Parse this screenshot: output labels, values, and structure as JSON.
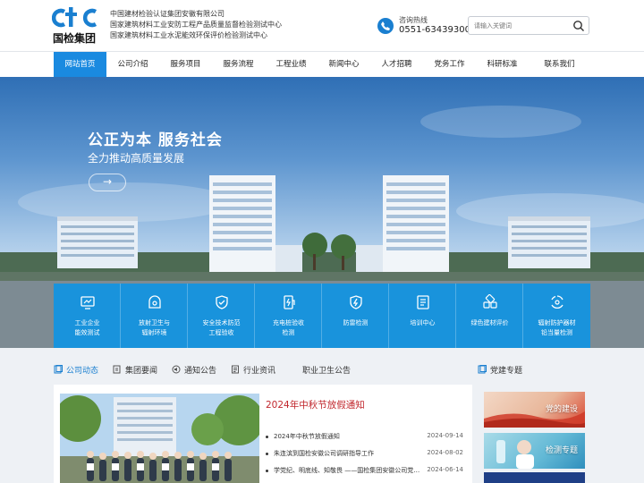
{
  "header": {
    "logo_mark": "ctc",
    "logo_text": "国检集团",
    "company_lines": [
      "中国建材检验认证集团安徽有限公司",
      "国家建筑材料工业安防工程产品质量监督检验测试中心",
      "国家建筑材料工业水泥能效环保评价检验测试中心"
    ],
    "hotline_label": "咨询热线",
    "hotline_number": "0551-63439300",
    "search_placeholder": "请输入关键词"
  },
  "nav": {
    "items": [
      "网站首页",
      "公司介绍",
      "服务项目",
      "服务流程",
      "工程业绩",
      "新闻中心",
      "人才招聘",
      "党务工作",
      "科研标准",
      "联系我们"
    ],
    "active_index": 0
  },
  "hero": {
    "title": "公正为本  服务社会",
    "subtitle": "全力推动高质量发展",
    "arrow": "→"
  },
  "services": [
    {
      "icon": "factory-meter-icon",
      "lines": [
        "工业企业",
        "能效测试"
      ]
    },
    {
      "icon": "radiation-icon",
      "lines": [
        "放射卫生与",
        "辐射环境"
      ]
    },
    {
      "icon": "shield-check-icon",
      "lines": [
        "安全技术防范",
        "工程验收"
      ]
    },
    {
      "icon": "charging-pile-icon",
      "lines": [
        "充电桩验收",
        "检测"
      ]
    },
    {
      "icon": "lightning-icon",
      "lines": [
        "防雷检测"
      ]
    },
    {
      "icon": "training-icon",
      "lines": [
        "培训中心"
      ]
    },
    {
      "icon": "green-material-icon",
      "lines": [
        "绿色建材评价"
      ]
    },
    {
      "icon": "radiation-protection-icon",
      "lines": [
        "辐射防护器材",
        "铅当量检测"
      ]
    }
  ],
  "news": {
    "tabs": [
      {
        "label": "公司动态",
        "icon": "document-icon"
      },
      {
        "label": "集团要闻",
        "icon": "document-icon"
      },
      {
        "label": "通知公告",
        "icon": "speaker-icon"
      },
      {
        "label": "行业资讯",
        "icon": "document-icon"
      },
      {
        "label": "职业卫生公告",
        "icon": ""
      }
    ],
    "active_tab": 0,
    "headline": "2024年中秋节放假通知",
    "items": [
      {
        "title": "2024年中秋节放假通知",
        "date": "2024-09-14"
      },
      {
        "title": "朱连滨到国检安徽公司调研指导工作",
        "date": "2024-08-02"
      },
      {
        "title": "学党纪、明底线、知敬畏 ——国检集团安徽公司党支...",
        "date": "2024-06-14"
      }
    ]
  },
  "party": {
    "heading": "党建专题",
    "cards": [
      {
        "label": "党的建设"
      },
      {
        "label": "检测专题"
      },
      {
        "label": ""
      }
    ]
  },
  "colors": {
    "accent": "#1a8ae0",
    "service_bar": "#1094e2",
    "headline_red": "#c1272d"
  }
}
